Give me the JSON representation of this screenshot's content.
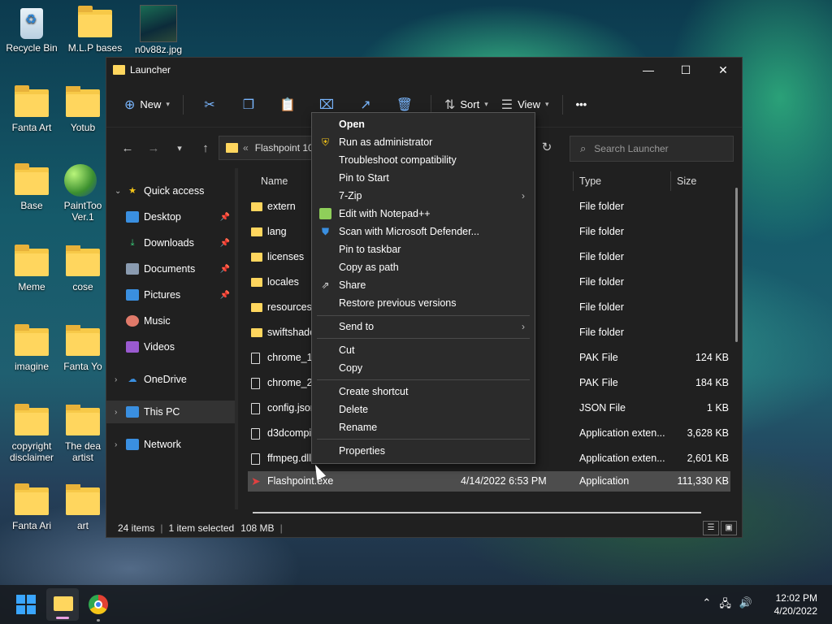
{
  "desktop": {
    "icons": [
      {
        "label": "Recycle Bin"
      },
      {
        "label": "M.L.P bases"
      },
      {
        "label": "n0v88z.jpg"
      },
      {
        "label": "Fanta Art"
      },
      {
        "label": "Yotub"
      },
      {
        "label": "Base"
      },
      {
        "label": "PaintToo Ver.1"
      },
      {
        "label": "Meme"
      },
      {
        "label": "cose"
      },
      {
        "label": "imagine"
      },
      {
        "label": "Fanta Yo"
      },
      {
        "label": "copyright disclaimer"
      },
      {
        "label": "The dea artist"
      },
      {
        "label": "Fanta Ari"
      },
      {
        "label": "art"
      }
    ]
  },
  "window": {
    "title": "Launcher",
    "controls": {
      "minimize": "—",
      "maximize": "☐",
      "close": "✕"
    }
  },
  "toolbar": {
    "new_label": "New",
    "sort_label": "Sort",
    "view_label": "View",
    "more_label": "•••"
  },
  "address": {
    "prefix": "«",
    "path": "Flashpoint 10"
  },
  "search": {
    "placeholder": "Search Launcher"
  },
  "sidebar": {
    "items": [
      {
        "label": "Quick access"
      },
      {
        "label": "Desktop"
      },
      {
        "label": "Downloads"
      },
      {
        "label": "Documents"
      },
      {
        "label": "Pictures"
      },
      {
        "label": "Music"
      },
      {
        "label": "Videos"
      },
      {
        "label": "OneDrive"
      },
      {
        "label": "This PC"
      },
      {
        "label": "Network"
      }
    ]
  },
  "columns": {
    "name": "Name",
    "type": "Type",
    "size": "Size"
  },
  "files": [
    {
      "name": "extern",
      "date": "M",
      "type": "File folder",
      "size": "",
      "kind": "folder"
    },
    {
      "name": "lang",
      "date": "AM",
      "type": "File folder",
      "size": "",
      "kind": "folder"
    },
    {
      "name": "licenses",
      "date": "M",
      "type": "File folder",
      "size": "",
      "kind": "folder"
    },
    {
      "name": "locales",
      "date": "M",
      "type": "File folder",
      "size": "",
      "kind": "folder"
    },
    {
      "name": "resources",
      "date": "M",
      "type": "File folder",
      "size": "",
      "kind": "folder"
    },
    {
      "name": "swiftshade",
      "date": "M",
      "type": "File folder",
      "size": "",
      "kind": "folder"
    },
    {
      "name": "chrome_10",
      "date": "M",
      "type": "PAK File",
      "size": "124 KB",
      "kind": "file"
    },
    {
      "name": "chrome_20",
      "date": "M",
      "type": "PAK File",
      "size": "184 KB",
      "kind": "file"
    },
    {
      "name": "config.json",
      "date": "M",
      "type": "JSON File",
      "size": "1 KB",
      "kind": "file"
    },
    {
      "name": "d3dcompi",
      "date": "M",
      "type": "Application exten...",
      "size": "3,628 KB",
      "kind": "file"
    },
    {
      "name": "ffmpeg.dll",
      "date": "M",
      "type": "Application exten...",
      "size": "2,601 KB",
      "kind": "file"
    },
    {
      "name": "Flashpoint.exe",
      "date": "4/14/2022 6:53 PM",
      "type": "Application",
      "size": "111,330 KB",
      "kind": "exe"
    }
  ],
  "status": {
    "items": "24 items",
    "selected": "1 item selected",
    "size": "108 MB"
  },
  "context_menu": {
    "open": "Open",
    "run_admin": "Run as administrator",
    "troubleshoot": "Troubleshoot compatibility",
    "pin_start": "Pin to Start",
    "zip": "7-Zip",
    "notepad": "Edit with Notepad++",
    "defender": "Scan with Microsoft Defender...",
    "pin_taskbar": "Pin to taskbar",
    "copy_path": "Copy as path",
    "share": "Share",
    "restore": "Restore previous versions",
    "send_to": "Send to",
    "cut": "Cut",
    "copy": "Copy",
    "create_shortcut": "Create shortcut",
    "delete": "Delete",
    "rename": "Rename",
    "properties": "Properties"
  },
  "taskbar": {
    "time": "12:02 PM",
    "date": "4/20/2022"
  }
}
